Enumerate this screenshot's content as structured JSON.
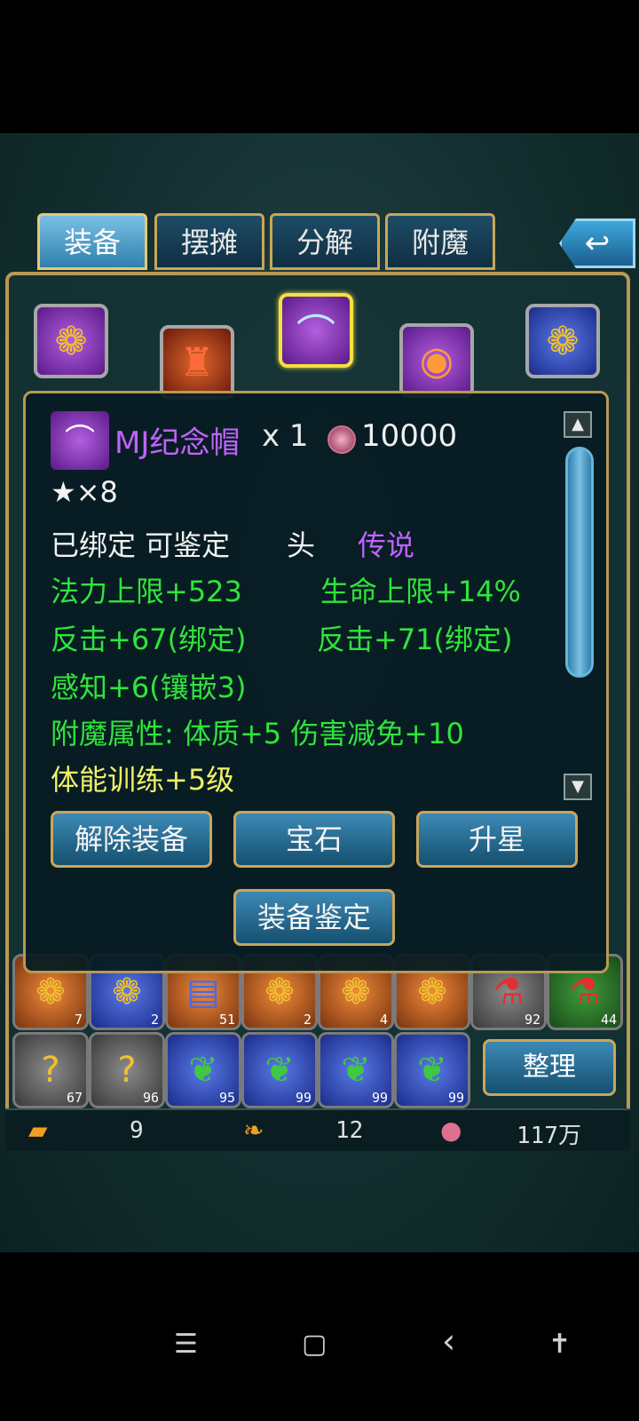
{
  "tabs": [
    {
      "label": "装备"
    },
    {
      "label": "摆摊"
    },
    {
      "label": "分解"
    },
    {
      "label": "附魔"
    }
  ],
  "back_icon": "↩",
  "item": {
    "name": "MJ纪念帽",
    "qty": "x 1",
    "price": "10000",
    "stars": "★×8",
    "bind_status": "已绑定 可鉴定",
    "slot": "头",
    "rarity": "传说",
    "attrs": [
      "法力上限+523",
      "生命上限+14%",
      "反击+67(绑定)",
      "反击+71(绑定)",
      "感知+6(镶嵌3)"
    ],
    "enchant": "附魔属性: 体质+5 伤害减免+10",
    "training": "体能训练+5级"
  },
  "popup_buttons": {
    "unequip": "解除装备",
    "gem": "宝石",
    "star_up": "升星",
    "identify": "装备鉴定"
  },
  "scroll": {
    "up": "▲",
    "down": "▼"
  },
  "sort_button": "整理",
  "inventory_row1_counts": [
    "7",
    "2",
    "51",
    "2",
    "4",
    "",
    "92",
    "44"
  ],
  "inventory_row2_counts": [
    "67",
    "96",
    "95",
    "99",
    "99",
    "99"
  ],
  "currency": {
    "gold": "9",
    "leaf": "12",
    "coins": "117万"
  },
  "nav": {
    "menu": "☰",
    "home": "▢",
    "back": "‹",
    "accessibility": "✝"
  }
}
